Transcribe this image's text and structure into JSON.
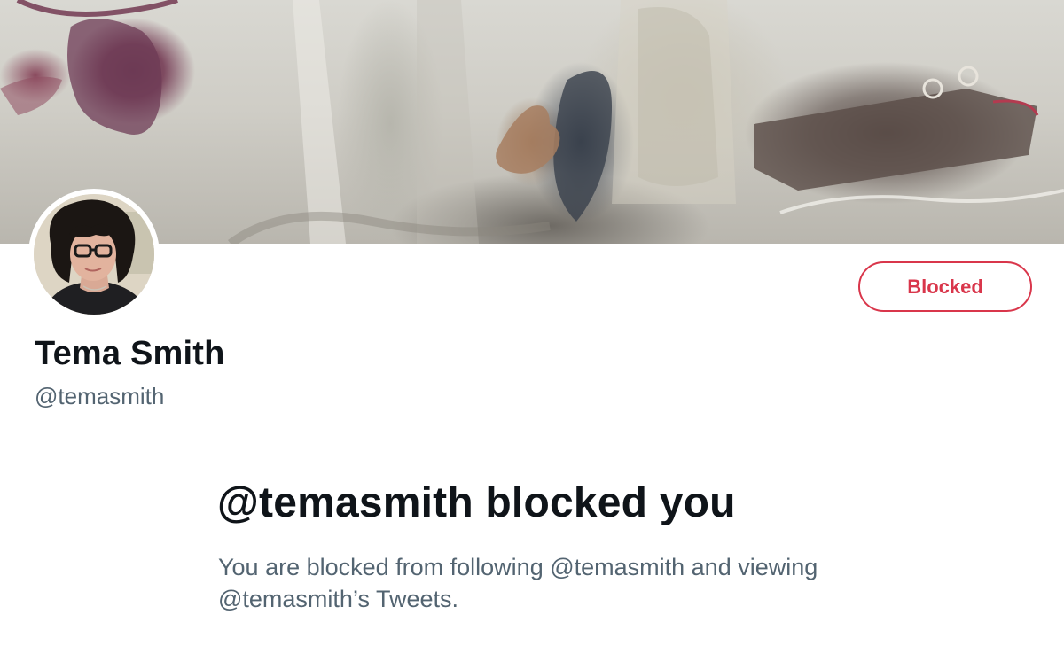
{
  "profile": {
    "display_name": "Tema Smith",
    "handle": "@temasmith"
  },
  "actions": {
    "blocked_label": "Blocked"
  },
  "notice": {
    "title": "@temasmith blocked you",
    "description": "You are blocked from following @temasmith and viewing @temasmith’s Tweets."
  },
  "colors": {
    "blocked_accent": "#d9364b",
    "primary_text": "#0f1419",
    "secondary_text": "#536471"
  },
  "icons": {
    "banner": "profile-banner-image",
    "avatar": "profile-avatar-image"
  }
}
